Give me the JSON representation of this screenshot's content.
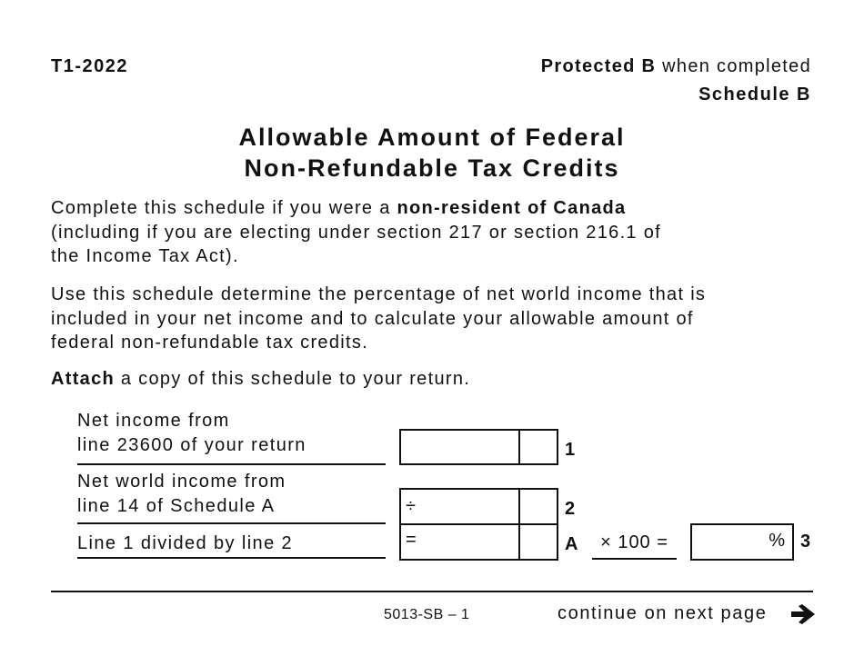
{
  "header": {
    "form_id": "T1-2022",
    "protected_bold": "Protected B",
    "protected_rest": " when completed",
    "schedule": "Schedule B"
  },
  "title": {
    "line1": "Allowable Amount of Federal",
    "line2": "Non-Refundable Tax Credits"
  },
  "intro": {
    "p1_prefix": "Complete this schedule if you were a ",
    "p1_bold": "non-resident of Canada",
    "p1_line2": "(including if you are electing under section 217 or section 216.1 of",
    "p1_line3": "the Income Tax Act).",
    "p2_line1": "Use this schedule determine the percentage of net world income that is",
    "p2_line2": "included in your net income and to calculate your allowable amount of",
    "p2_line3": "federal non-refundable tax credits.",
    "p3_bold": "Attach",
    "p3_rest": " a copy of this schedule to your return."
  },
  "lines": [
    {
      "label_line1": "Net income from",
      "label_line2": "line 23600 of your return",
      "operator": "",
      "dollars": "",
      "cents": "",
      "line_number": "1"
    },
    {
      "label_line1": "Net world income from",
      "label_line2": "line 14 of Schedule A",
      "operator": "÷",
      "dollars": "",
      "cents": "",
      "line_number": "2"
    },
    {
      "label_line1": "Line 1 divided by line 2",
      "operator": "=",
      "dollars": "",
      "cents": "",
      "line_number": "A"
    }
  ],
  "calc": {
    "multiplier_text": "× 100 =",
    "percent_value": "",
    "percent_sign": "%",
    "line_number": "3"
  },
  "footer": {
    "form_code": "5013-SB – 1",
    "continue_text": "continue on next page",
    "arrow_icon": "right-arrow"
  }
}
